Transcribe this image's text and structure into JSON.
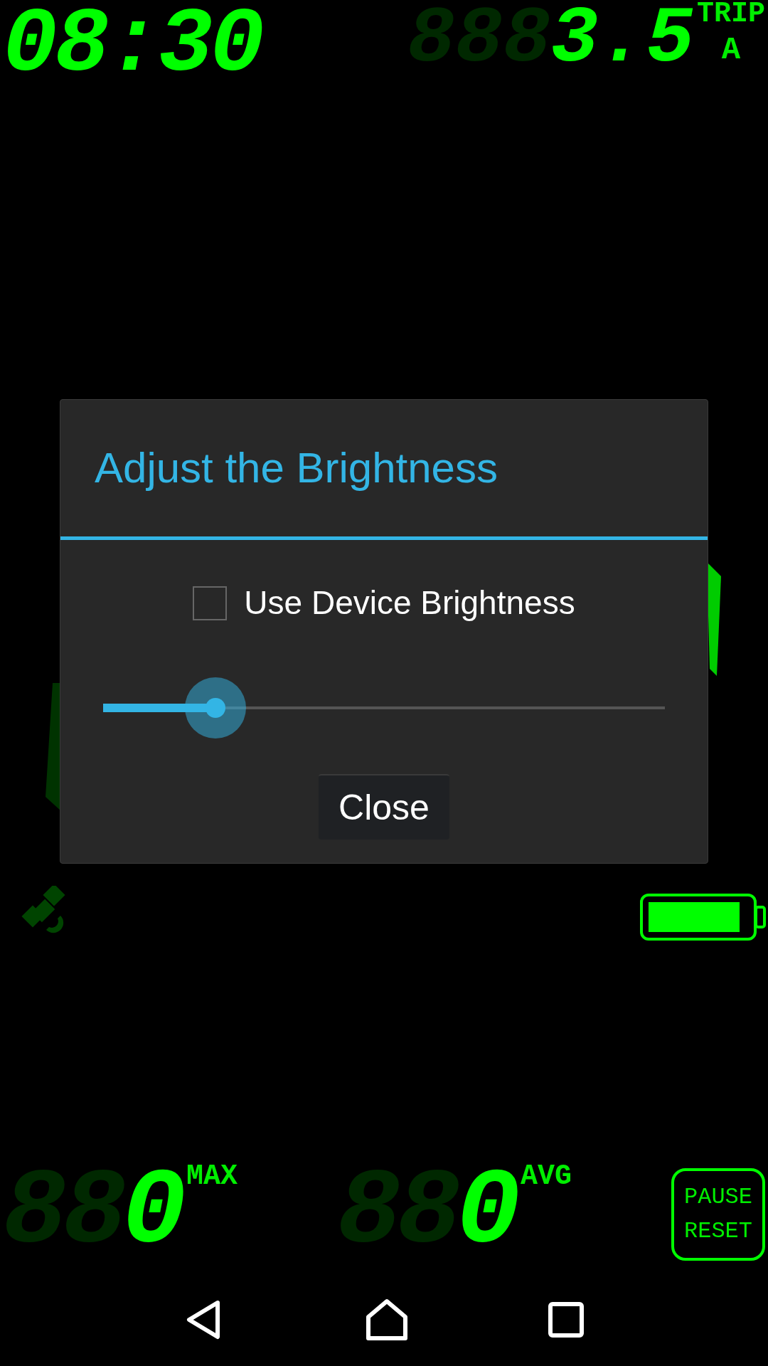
{
  "clock": {
    "time": "08:30"
  },
  "trip": {
    "ghost": "888",
    "value": "3.5",
    "label": "TRIP",
    "mode": "A"
  },
  "dialog": {
    "title": "Adjust the Brightness",
    "checkbox": {
      "label": "Use Device Brightness",
      "checked": false
    },
    "slider": {
      "level": 0.2
    },
    "button": "Close"
  },
  "max": {
    "ghost": "88",
    "value": "0",
    "label": "MAX"
  },
  "avg": {
    "ghost": "88",
    "value": "0",
    "label": "AVG"
  },
  "pause_reset": [
    "PAUSE",
    "RESET"
  ]
}
